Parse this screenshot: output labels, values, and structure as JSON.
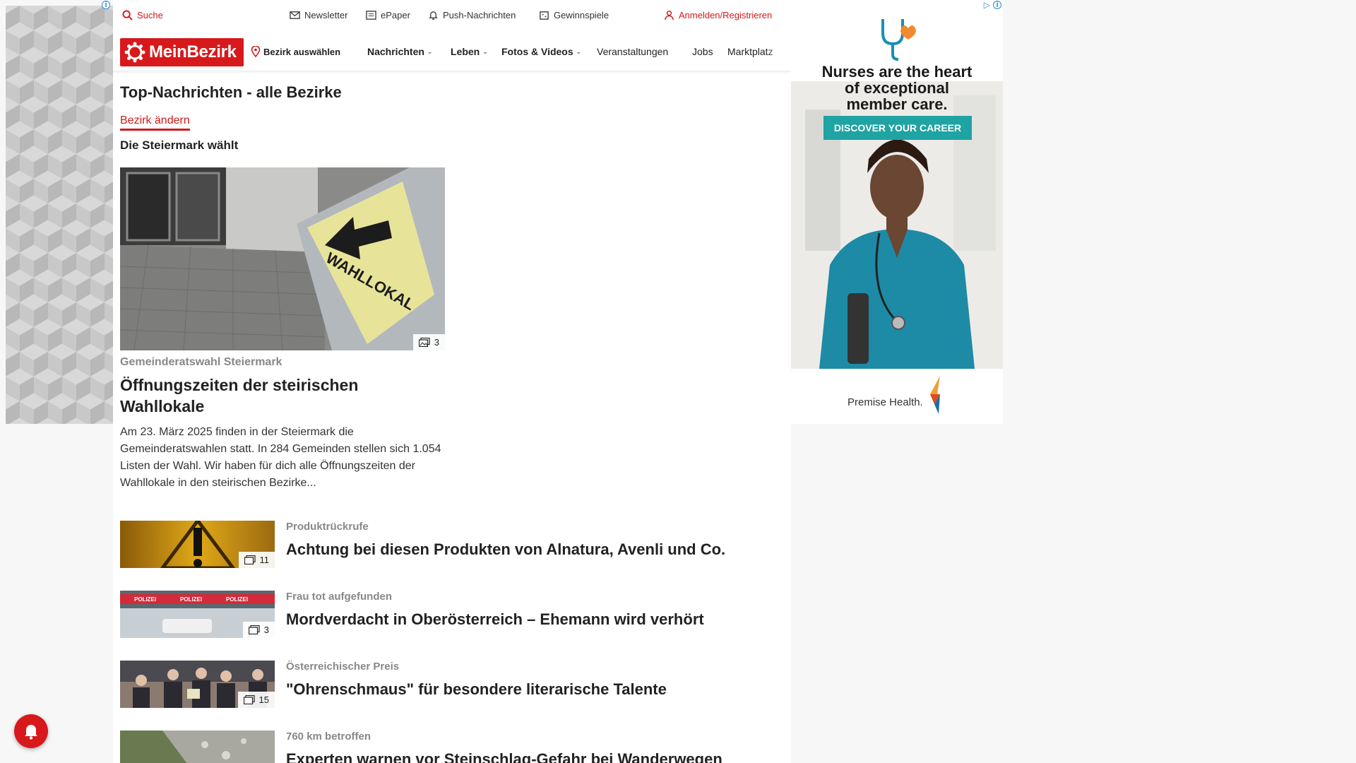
{
  "topbar": {
    "search_label": "Suche",
    "newsletter_label": "Newsletter",
    "epaper_label": "ePaper",
    "push_label": "Push-Nachrichten",
    "gewinnspiele_label": "Gewinnspiele",
    "login_label": "Anmelden/Registrieren"
  },
  "nav": {
    "logo_text": "MeinBezirk",
    "district_label": "Bezirk auswählen",
    "items": [
      {
        "label": "Nachrichten"
      },
      {
        "label": "Leben"
      },
      {
        "label": "Fotos & Videos"
      },
      {
        "label": "Veranstaltungen"
      },
      {
        "label": "Jobs"
      },
      {
        "label": "Marktplatz"
      }
    ]
  },
  "main": {
    "page_title": "Top-Nachrichten - alle Bezirke",
    "change_district": "Bezirk ändern",
    "section_title": "Die Steiermark wählt",
    "hero": {
      "image_sign_text": "WAHLLOKAL",
      "image_count": "3",
      "kicker": "Gemeinderatswahl Steiermark",
      "title": "Öffnungszeiten der steirischen Wahllokale",
      "teaser": "Am 23. März 2025 finden in der Steiermark die Gemeinderatswahlen statt. In 284 Gemeinden stellen sich 1.054 Listen der Wahl. Wir haben für dich alle Öffnungszeiten der Wahllokale in den steirischen Bezirke..."
    },
    "articles": [
      {
        "kicker": "Produktrückrufe",
        "title": "Achtung bei diesen Produkten von Alnatura, Avenli und Co.",
        "image_count": "11"
      },
      {
        "kicker": "Frau tot aufgefunden",
        "title": "Mordverdacht in Oberösterreich – Ehemann wird verhört",
        "image_count": "3",
        "image_tape_text": "POLIZEI"
      },
      {
        "kicker": "Österreichischer Preis",
        "title": "\"Ohrenschmaus\" für besondere literarische Talente",
        "image_count": "15"
      },
      {
        "kicker": "760 km betroffen",
        "title": "Experten warnen vor Steinschlag-Gefahr bei Wanderwegen"
      }
    ]
  },
  "right_ad": {
    "headline": "Nurses are the heart of exceptional member care.",
    "cta": "DISCOVER YOUR CAREER",
    "brand": "Premise Health."
  },
  "colors": {
    "brand_red": "#d7191c",
    "ad_teal": "#1fa3a3"
  },
  "icons": [
    "search-icon",
    "mail-icon",
    "newspaper-icon",
    "bell-icon",
    "gift-icon",
    "user-icon",
    "location-pin-icon",
    "chevron-down-icon",
    "gallery-icon",
    "notification-bell-icon"
  ]
}
